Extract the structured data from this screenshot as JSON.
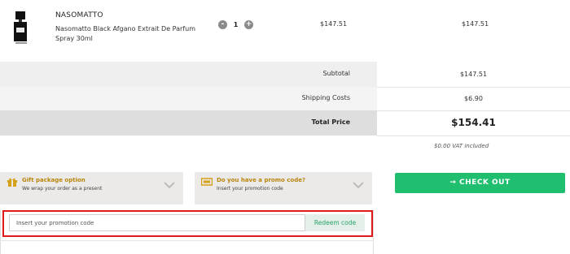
{
  "product": {
    "brand": "NASOMATTO",
    "name": "Nasomatto Black Afgano Extrait De Parfum Spray 30ml",
    "quantity": "1",
    "decrease_label": "-",
    "increase_label": "+",
    "unit_price": "$147.51",
    "line_total": "$147.51"
  },
  "summary": {
    "subtotal_label": "Subtotal",
    "subtotal_value": "$147.51",
    "shipping_label": "Shipping Costs",
    "shipping_value": "$6.90",
    "total_label": "Total Price",
    "total_value": "$154.41",
    "vat_note": "$0.00 VAT included"
  },
  "gift_panel": {
    "title": "Gift package option",
    "subtitle": "We wrap your order as a present",
    "icon": "gift-icon"
  },
  "promo_panel": {
    "title": "Do you have a promo code?",
    "subtitle": "Insert your promotion code",
    "icon": "ticket-icon"
  },
  "checkout": {
    "label": "→ CHECK OUT",
    "color": "#1fbf6f"
  },
  "promo_form": {
    "placeholder": "Insert your promotion code",
    "value": "",
    "redeem_label": "Redeem code"
  },
  "colors": {
    "accent_gold": "#b8860b",
    "highlight_red": "#e01a1a",
    "redeem_green": "#2aa46a"
  }
}
